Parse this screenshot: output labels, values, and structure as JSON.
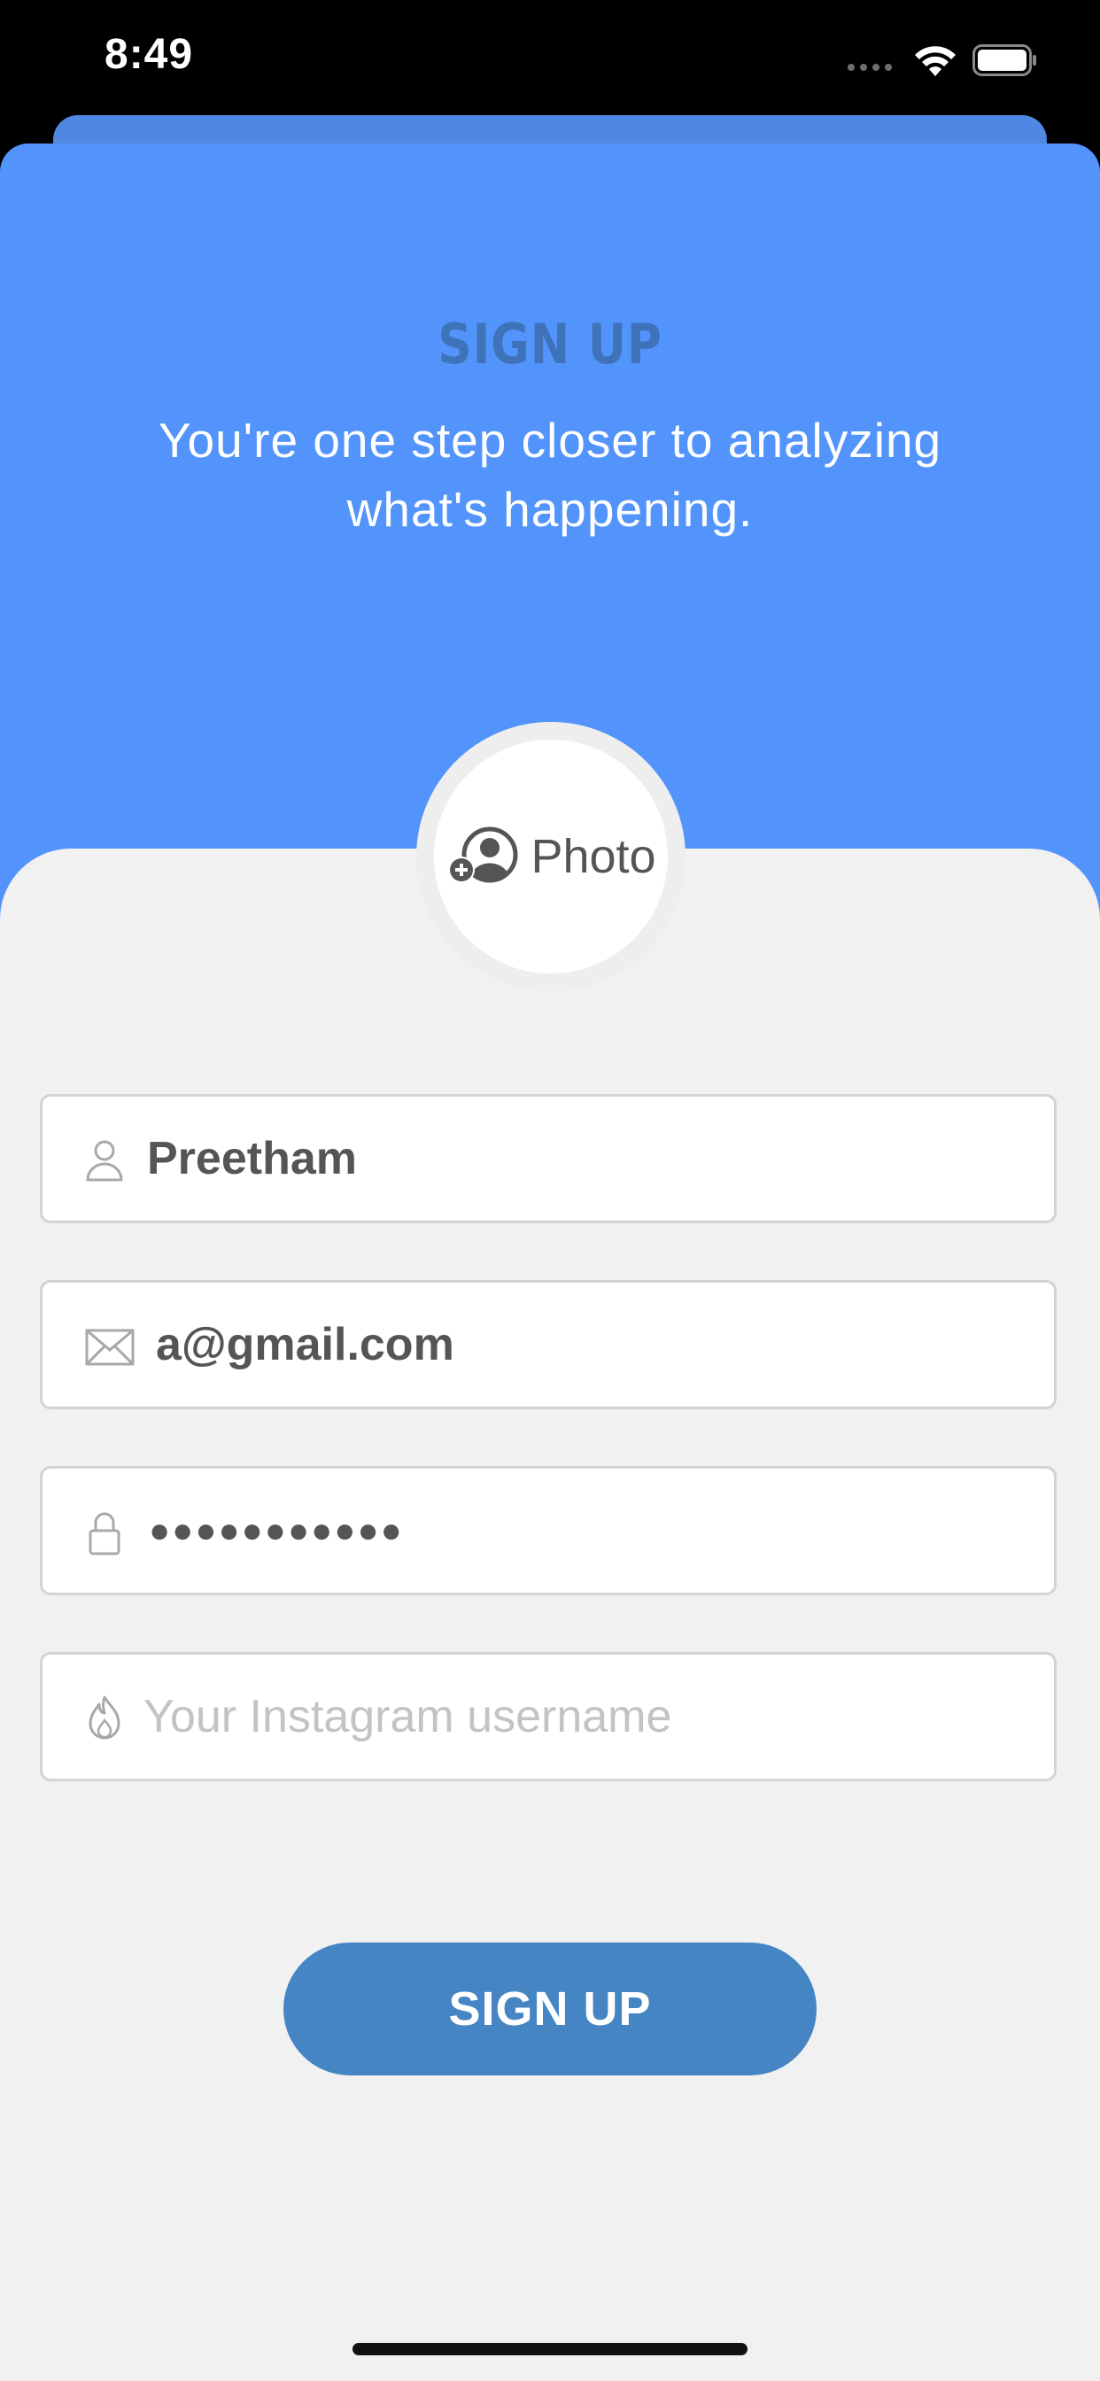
{
  "status_bar": {
    "time": "8:49"
  },
  "header": {
    "title": "SIGN UP",
    "subtitle": "You're one step closer to analyzing what's happening."
  },
  "photo": {
    "label": "Photo",
    "icon": "add-user-photo-icon"
  },
  "form": {
    "name": {
      "value": "Preetham",
      "icon": "person-icon"
    },
    "email": {
      "value": "a@gmail.com",
      "icon": "envelope-icon"
    },
    "password": {
      "masked_value": "●●●●●●●●●●●",
      "icon": "lock-icon"
    },
    "instagram": {
      "placeholder": "Your Instagram username",
      "value": "",
      "icon": "flame-icon"
    }
  },
  "buttons": {
    "signup_label": "SIGN UP"
  },
  "colors": {
    "header_blue": "#5294fb",
    "title_blue": "#3f73b9",
    "button_blue": "#4585c4",
    "form_background": "#f1f1f1"
  }
}
